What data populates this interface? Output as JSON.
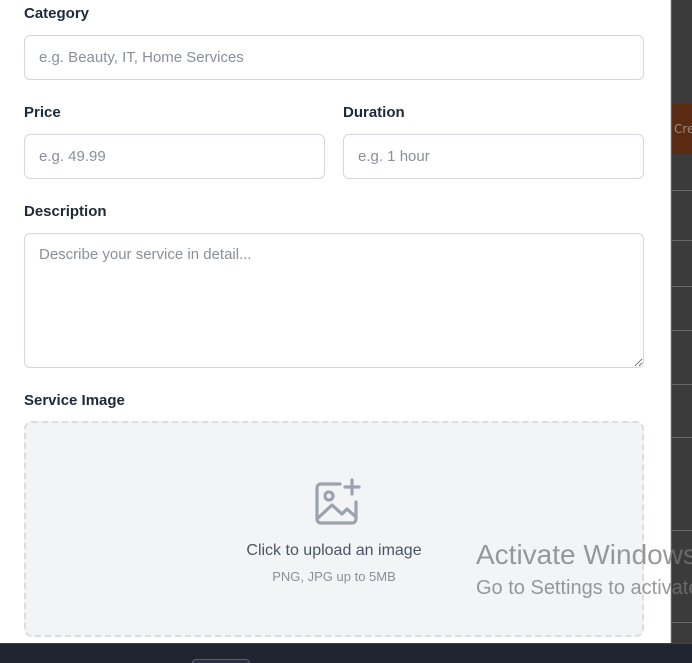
{
  "form": {
    "category": {
      "label": "Category",
      "placeholder": "e.g. Beauty, IT, Home Services"
    },
    "price": {
      "label": "Price",
      "placeholder": "e.g. 49.99"
    },
    "duration": {
      "label": "Duration",
      "placeholder": "e.g. 1 hour"
    },
    "description": {
      "label": "Description",
      "placeholder": "Describe your service in detail..."
    },
    "image": {
      "label": "Service Image",
      "upload_title": "Click to upload an image",
      "upload_hint": "PNG, JPG up to 5MB",
      "icon": "image-add-icon"
    }
  },
  "background": {
    "accent_fragment": "Crea",
    "accent_color": "#5a2a12"
  },
  "watermark": {
    "line1": "Activate Windows",
    "line2": "Go to Settings to activate Windows."
  }
}
